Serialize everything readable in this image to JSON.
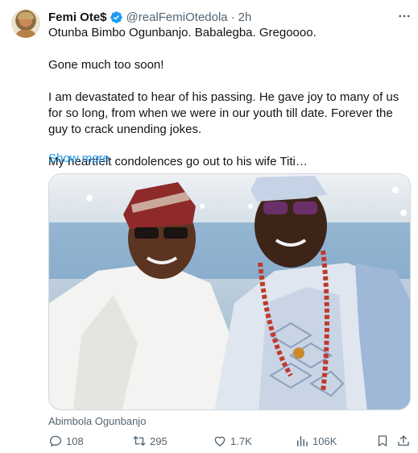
{
  "author": {
    "name": "Femi Ote$",
    "handle": "@realFemiOtedola",
    "separator": "·",
    "time": "2h"
  },
  "tweet": {
    "lines": [
      "Otunba Bimbo Ogunbanjo. Babalegba. Gregoooo.",
      "Gone much too soon!",
      "I am devastated to hear of his passing. He gave joy to many of us for so long, from when we were in our youth till date. Forever the guy to crack unending jokes.",
      "My heartfelt condolences go out to his wife Titi…"
    ],
    "show_more": "Show more",
    "media_caption": "Abimbola Ogunbanjo"
  },
  "actions": {
    "replies": "108",
    "reposts": "295",
    "likes": "1.7K",
    "views": "106K"
  },
  "icons": {
    "verified": "verified-badge-icon",
    "more": "more-horizontal-icon",
    "reply": "reply-icon",
    "repost": "repost-icon",
    "like": "heart-icon",
    "views": "views-chart-icon",
    "bookmark": "bookmark-icon",
    "share": "share-icon"
  },
  "colors": {
    "text": "#0f1419",
    "secondary": "#536471",
    "link": "#1d9bf0",
    "verified": "#1d9bf0"
  }
}
